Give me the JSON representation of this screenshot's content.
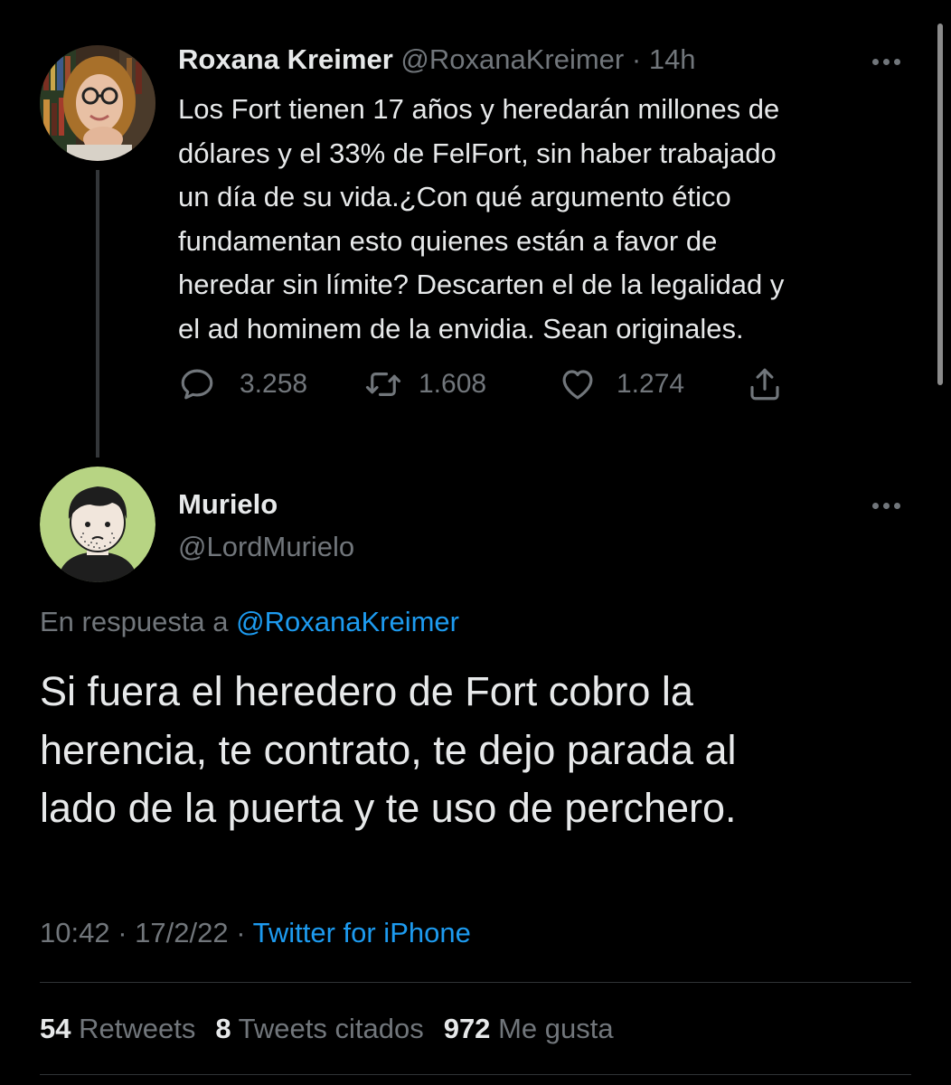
{
  "parent_tweet": {
    "display_name": "Roxana Kreimer",
    "handle": "@RoxanaKreimer",
    "separator": "·",
    "time_ago": "14h",
    "text_lines": [
      "Los Fort tienen 17 años y heredarán millones de",
      "dólares y el 33% de FelFort, sin haber trabajado",
      "un día de su vida.¿Con qué argumento ético",
      "fundamentan esto quienes están a favor de",
      "heredar sin límite? Descarten el de la legalidad y",
      "el ad hominem de la envidia. Sean originales."
    ],
    "replies": "3.258",
    "retweets": "1.608",
    "likes": "1.274",
    "icons": [
      "reply-icon",
      "retweet-icon",
      "like-icon",
      "share-icon",
      "more-icon"
    ]
  },
  "main_tweet": {
    "display_name": "Murielo",
    "handle": "@LordMurielo",
    "reply_prefix": "En respuesta a",
    "reply_handle": "@RoxanaKreimer",
    "text_lines": [
      "Si fuera el heredero de Fort cobro la",
      "herencia, te contrato, te dejo parada al",
      "lado de la puerta y te uso de perchero."
    ],
    "time": "10:42",
    "separator": "·",
    "date": "17/2/22",
    "source": "Twitter for iPhone",
    "stats": {
      "retweets_count": "54",
      "retweets_label": "Retweets",
      "quotes_count": "8",
      "quotes_label": "Tweets citados",
      "likes_count": "972",
      "likes_label": "Me gusta"
    }
  },
  "colors": {
    "background": "#000000",
    "text": "#e7e9ea",
    "muted": "#71767b",
    "link": "#1d9bf0",
    "divider": "#2f3336"
  }
}
